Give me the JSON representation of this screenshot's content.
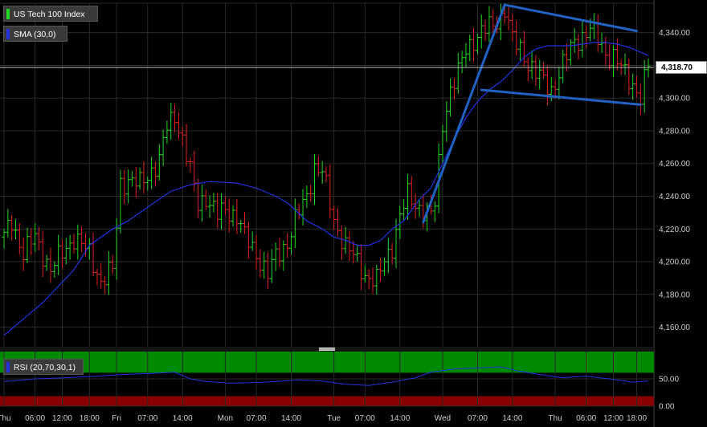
{
  "chart_data": [
    {
      "type": "candlestick",
      "title": "",
      "series": [
        {
          "name": "US Tech 100 Index",
          "color": "#22d822",
          "down_color": "#e02020"
        },
        {
          "name": "SMA (30,0)",
          "color": "#2233dd"
        }
      ],
      "ylim": [
        4148,
        4358
      ],
      "y_ticks": [
        "4,160.00",
        "4,180.00",
        "4,200.00",
        "4,220.00",
        "4,240.00",
        "4,260.00",
        "4,280.00",
        "4,300.00",
        "4,320.00",
        "4,340.00"
      ],
      "y_tick_values": [
        4160,
        4180,
        4200,
        4220,
        4240,
        4260,
        4280,
        4300,
        4320,
        4340
      ],
      "last_price": 4318.7,
      "last_price_label": "4,318.70",
      "close_path": [
        [
          0,
          4215
        ],
        [
          2,
          4225
        ],
        [
          5,
          4205
        ],
        [
          8,
          4215
        ],
        [
          12,
          4195
        ],
        [
          15,
          4205
        ],
        [
          18,
          4215
        ],
        [
          22,
          4205
        ],
        [
          25,
          4188
        ],
        [
          28,
          4195
        ],
        [
          30,
          4248
        ],
        [
          32,
          4250
        ],
        [
          35,
          4247
        ],
        [
          40,
          4262
        ],
        [
          42,
          4282
        ],
        [
          44,
          4290
        ],
        [
          46,
          4275
        ],
        [
          48,
          4255
        ],
        [
          50,
          4235
        ],
        [
          52,
          4240
        ],
        [
          55,
          4228
        ],
        [
          57,
          4232
        ],
        [
          60,
          4228
        ],
        [
          62,
          4215
        ],
        [
          65,
          4205
        ],
        [
          68,
          4192
        ],
        [
          70,
          4203
        ],
        [
          73,
          4212
        ],
        [
          75,
          4225
        ],
        [
          78,
          4240
        ],
        [
          80,
          4258
        ],
        [
          82,
          4255
        ],
        [
          85,
          4225
        ],
        [
          88,
          4210
        ],
        [
          90,
          4203
        ],
        [
          93,
          4192
        ],
        [
          96,
          4188
        ],
        [
          98,
          4200
        ],
        [
          100,
          4210
        ],
        [
          102,
          4228
        ],
        [
          104,
          4240
        ],
        [
          106,
          4235
        ],
        [
          108,
          4232
        ],
        [
          110,
          4228
        ],
        [
          111,
          4235
        ],
        [
          113,
          4285
        ],
        [
          115,
          4305
        ],
        [
          117,
          4315
        ],
        [
          119,
          4330
        ],
        [
          121,
          4336
        ],
        [
          123,
          4340
        ],
        [
          126,
          4345
        ],
        [
          128,
          4350
        ],
        [
          129,
          4355
        ],
        [
          131,
          4335
        ],
        [
          133,
          4330
        ],
        [
          135,
          4322
        ],
        [
          137,
          4315
        ],
        [
          139,
          4310
        ],
        [
          141,
          4305
        ],
        [
          143,
          4315
        ],
        [
          145,
          4325
        ],
        [
          147,
          4335
        ],
        [
          149,
          4338
        ],
        [
          151,
          4342
        ],
        [
          153,
          4336
        ],
        [
          155,
          4328
        ],
        [
          157,
          4325
        ],
        [
          159,
          4318
        ],
        [
          161,
          4312
        ],
        [
          163,
          4305
        ],
        [
          164,
          4300
        ],
        [
          165,
          4310
        ],
        [
          166,
          4320
        ]
      ],
      "sma_path": [
        [
          0,
          4155
        ],
        [
          10,
          4175
        ],
        [
          18,
          4195
        ],
        [
          22,
          4210
        ],
        [
          28,
          4220
        ],
        [
          32,
          4225
        ],
        [
          38,
          4235
        ],
        [
          43,
          4243
        ],
        [
          48,
          4247
        ],
        [
          53,
          4249
        ],
        [
          60,
          4248
        ],
        [
          65,
          4245
        ],
        [
          70,
          4240
        ],
        [
          73,
          4236
        ],
        [
          78,
          4225
        ],
        [
          82,
          4220
        ],
        [
          85,
          4215
        ],
        [
          88,
          4213
        ],
        [
          91,
          4210
        ],
        [
          94,
          4210
        ],
        [
          97,
          4213
        ],
        [
          100,
          4220
        ],
        [
          103,
          4225
        ],
        [
          107,
          4238
        ],
        [
          110,
          4245
        ],
        [
          113,
          4260
        ],
        [
          116,
          4275
        ],
        [
          119,
          4288
        ],
        [
          122,
          4298
        ],
        [
          125,
          4305
        ],
        [
          128,
          4310
        ],
        [
          131,
          4317
        ],
        [
          134,
          4325
        ],
        [
          137,
          4330
        ],
        [
          140,
          4332
        ],
        [
          143,
          4332
        ],
        [
          146,
          4332
        ],
        [
          149,
          4333
        ],
        [
          152,
          4334
        ],
        [
          155,
          4334
        ],
        [
          158,
          4333
        ],
        [
          161,
          4331
        ],
        [
          164,
          4328
        ],
        [
          166,
          4326
        ]
      ],
      "trendlines": [
        {
          "from": [
            108,
            4224
          ],
          "to": [
            129,
            4357
          ]
        },
        {
          "from": [
            129,
            4357
          ],
          "to": [
            163,
            4341
          ]
        },
        {
          "from": [
            123,
            4305
          ],
          "to": [
            164,
            4296
          ]
        }
      ],
      "x_ticks": [
        {
          "label": "Thu",
          "index": 0
        },
        {
          "label": "06:00",
          "index": 8
        },
        {
          "label": "12:00",
          "index": 15
        },
        {
          "label": "18:00",
          "index": 22
        },
        {
          "label": "Fri",
          "index": 29
        },
        {
          "label": "07:00",
          "index": 37
        },
        {
          "label": "14:00",
          "index": 46
        },
        {
          "label": "Mon",
          "index": 57
        },
        {
          "label": "07:00",
          "index": 65
        },
        {
          "label": "14:00",
          "index": 74
        },
        {
          "label": "Tue",
          "index": 85
        },
        {
          "label": "07:00",
          "index": 93
        },
        {
          "label": "14:00",
          "index": 102
        },
        {
          "label": "Wed",
          "index": 113
        },
        {
          "label": "07:00",
          "index": 122
        },
        {
          "label": "14:00",
          "index": 131
        },
        {
          "label": "Thu",
          "index": 142
        },
        {
          "label": "06:00",
          "index": 150
        },
        {
          "label": "12:00",
          "index": 157
        },
        {
          "label": "18:00",
          "index": 163
        }
      ],
      "x_count": 167
    },
    {
      "type": "line",
      "series": [
        {
          "name": "RSI (20,70,30,1)",
          "color": "#2233dd"
        }
      ],
      "ylim": [
        0,
        100
      ],
      "overbought": 70,
      "oversold": 30,
      "y_ticks": [
        "50.00",
        "0.00"
      ],
      "y_tick_values": [
        50,
        0
      ],
      "values_path": [
        [
          0,
          45
        ],
        [
          8,
          50
        ],
        [
          16,
          52
        ],
        [
          24,
          55
        ],
        [
          30,
          58
        ],
        [
          38,
          60
        ],
        [
          44,
          62
        ],
        [
          48,
          50
        ],
        [
          52,
          45
        ],
        [
          58,
          42
        ],
        [
          64,
          43
        ],
        [
          70,
          45
        ],
        [
          76,
          48
        ],
        [
          82,
          46
        ],
        [
          88,
          40
        ],
        [
          94,
          38
        ],
        [
          100,
          44
        ],
        [
          106,
          52
        ],
        [
          110,
          62
        ],
        [
          116,
          68
        ],
        [
          122,
          70
        ],
        [
          128,
          72
        ],
        [
          132,
          65
        ],
        [
          138,
          58
        ],
        [
          144,
          52
        ],
        [
          150,
          55
        ],
        [
          156,
          50
        ],
        [
          162,
          44
        ],
        [
          166,
          46
        ]
      ]
    }
  ]
}
